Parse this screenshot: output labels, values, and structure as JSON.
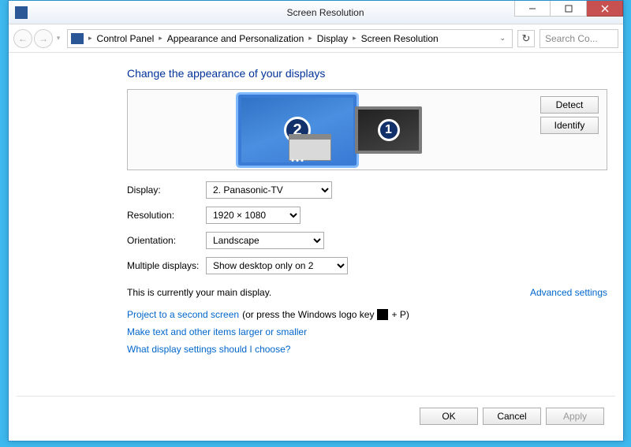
{
  "titlebar": {
    "title": "Screen Resolution"
  },
  "breadcrumb": {
    "items": [
      "Control Panel",
      "Appearance and Personalization",
      "Display",
      "Screen Resolution"
    ]
  },
  "search": {
    "placeholder": "Search Co..."
  },
  "heading": "Change the appearance of your displays",
  "monitors": {
    "selected_num": "2",
    "other_num": "1"
  },
  "buttons": {
    "detect": "Detect",
    "identify": "Identify"
  },
  "form": {
    "display_label": "Display:",
    "display_value": "2. Panasonic-TV",
    "resolution_label": "Resolution:",
    "resolution_value": "1920 × 1080",
    "orientation_label": "Orientation:",
    "orientation_value": "Landscape",
    "multiple_label": "Multiple displays:",
    "multiple_value": "Show desktop only on 2"
  },
  "main_display_text": "This is currently your main display.",
  "advanced_link": "Advanced settings",
  "hints": {
    "project_link": "Project to a second screen",
    "project_rest_a": " (or press the Windows logo key ",
    "project_rest_b": " + P)",
    "larger_link": "Make text and other items larger or smaller",
    "which_link": "What display settings should I choose?"
  },
  "footer": {
    "ok": "OK",
    "cancel": "Cancel",
    "apply": "Apply"
  }
}
